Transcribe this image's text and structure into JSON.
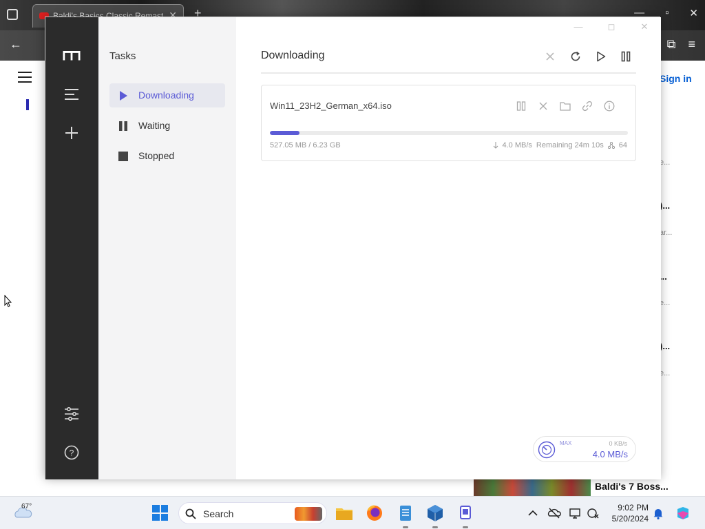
{
  "browser": {
    "tab_title": "Baldi's Basics Classic Remaster",
    "tab_close": "✕",
    "new_tab": "+",
    "sign_in": "Sign in",
    "side_fragments": [
      "e...",
      ")...",
      "ar...",
      "...",
      "e...",
      ")...",
      "e..."
    ],
    "bottom_video_title": "Baldi's 7 Boss..."
  },
  "app": {
    "window_controls": {
      "minimize": "—",
      "maximize": "◻",
      "close": "✕"
    },
    "sidebar": {
      "title": "Tasks",
      "items": [
        {
          "label": "Downloading",
          "icon": "play-icon",
          "active": true
        },
        {
          "label": "Waiting",
          "icon": "pause-icon",
          "active": false
        },
        {
          "label": "Stopped",
          "icon": "stop-icon",
          "active": false
        }
      ]
    },
    "main": {
      "title": "Downloading",
      "toolbar": [
        "close-icon",
        "refresh-icon",
        "play-icon",
        "pause-icon"
      ]
    },
    "task": {
      "filename": "Win11_23H2_German_x64.iso",
      "progress": 0.0826,
      "size": "527.05 MB / 6.23 GB",
      "speed": "4.0 MB/s",
      "remaining": "Remaining 24m 10s",
      "connections": "64"
    },
    "speedometer": {
      "max_label": "MAX",
      "upload": "0 KB/s",
      "download": "4.0 MB/s"
    }
  },
  "taskbar": {
    "temperature": "67°",
    "search_label": "Search",
    "time": "9:02 PM",
    "date": "5/20/2024"
  },
  "colors": {
    "accent": "#5b5bd6",
    "rail": "#2b2b2b",
    "sidebar": "#f4f4f5"
  }
}
